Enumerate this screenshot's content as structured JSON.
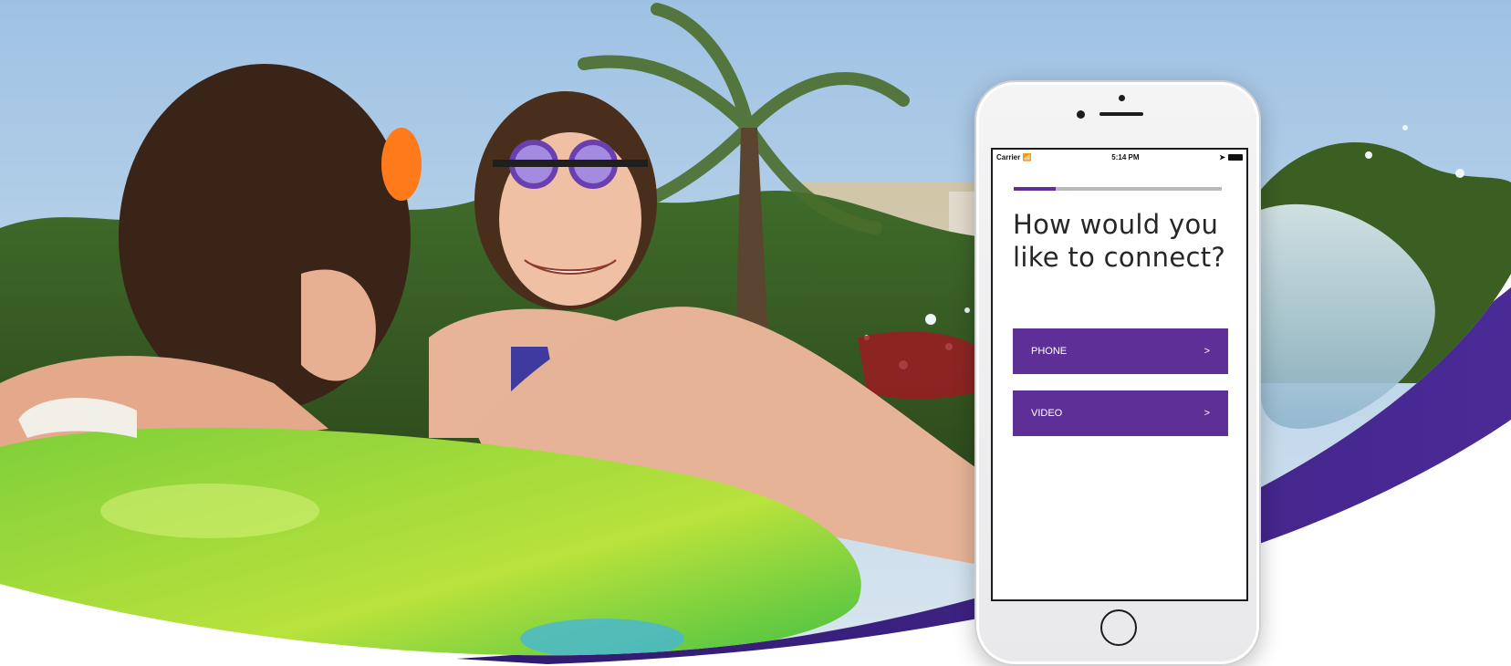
{
  "phone": {
    "status_bar": {
      "carrier": "Carrier",
      "wifi_icon": "wifi-icon",
      "time": "5:14 PM",
      "location_icon": "location-arrow-icon",
      "battery_icon": "battery-icon"
    },
    "progress": {
      "fraction": 0.2
    },
    "question": "How would you like to connect?",
    "options": [
      {
        "label": "PHONE",
        "arrow": ">"
      },
      {
        "label": "VIDEO",
        "arrow": ">"
      }
    ]
  },
  "colors": {
    "brand_purple": "#5e2f96",
    "deep_purple": "#3a1f7a",
    "sky": "#aac9e6"
  }
}
